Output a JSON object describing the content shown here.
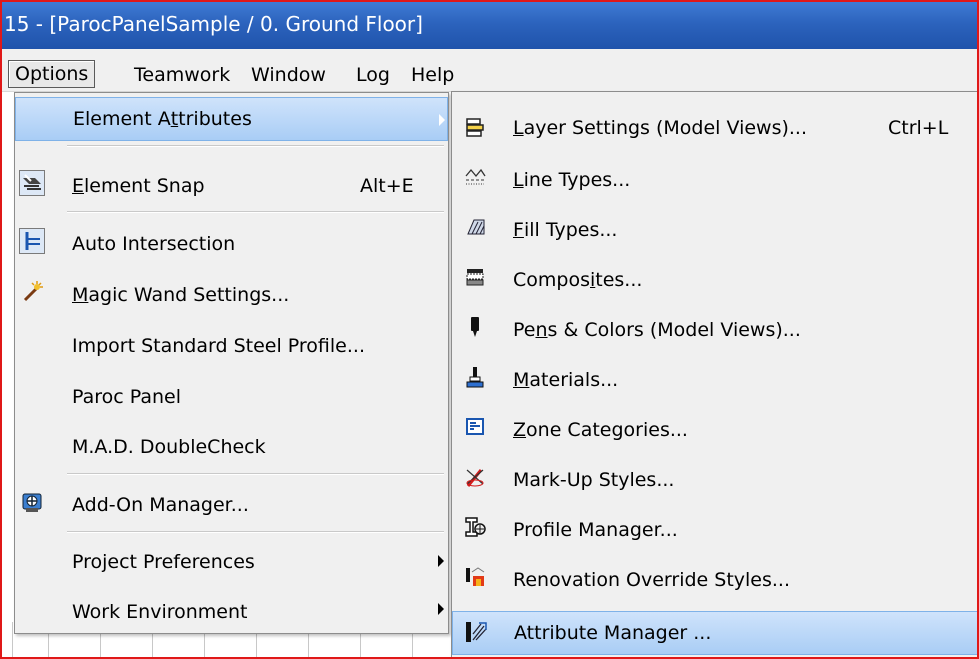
{
  "window": {
    "title": "15 - [ParocPanelSample / 0. Ground Floor]"
  },
  "menubar": [
    "Options",
    "Teamwork",
    "Window",
    "Log",
    "Help"
  ],
  "options_menu": [
    {
      "label": "Element Attributes",
      "shortcut": "",
      "icon": "",
      "submenu": true,
      "highlighted": true
    },
    {
      "label": "Element Snap",
      "shortcut": "Alt+E",
      "icon": "snap-icon",
      "submenu": false
    },
    {
      "label": "Auto Intersection",
      "shortcut": "",
      "icon": "intersection-icon",
      "submenu": false
    },
    {
      "label": "Magic Wand Settings...",
      "shortcut": "",
      "icon": "magic-wand-icon",
      "submenu": false
    },
    {
      "label": "Import Standard Steel Profile...",
      "shortcut": "",
      "icon": "",
      "submenu": false
    },
    {
      "label": "Paroc Panel",
      "shortcut": "",
      "icon": "",
      "submenu": false
    },
    {
      "label": "M.A.D. DoubleCheck",
      "shortcut": "",
      "icon": "",
      "submenu": false
    },
    {
      "label": "Add-On Manager...",
      "shortcut": "",
      "icon": "addon-manager-icon",
      "submenu": false
    },
    {
      "label": "Project Preferences",
      "shortcut": "",
      "icon": "",
      "submenu": true
    },
    {
      "label": "Work Environment",
      "shortcut": "",
      "icon": "",
      "submenu": true
    }
  ],
  "attributes_submenu": [
    {
      "label": "Layer Settings (Model Views)...",
      "shortcut": "Ctrl+L",
      "icon": "layers-icon"
    },
    {
      "label": "Line Types...",
      "shortcut": "",
      "icon": "line-types-icon"
    },
    {
      "label": "Fill Types...",
      "shortcut": "",
      "icon": "fill-types-icon"
    },
    {
      "label": "Composites...",
      "shortcut": "",
      "icon": "composites-icon"
    },
    {
      "label": "Pens & Colors (Model Views)...",
      "shortcut": "",
      "icon": "pen-icon"
    },
    {
      "label": "Materials...",
      "shortcut": "",
      "icon": "materials-icon"
    },
    {
      "label": "Zone Categories...",
      "shortcut": "",
      "icon": "zone-icon"
    },
    {
      "label": "Mark-Up Styles...",
      "shortcut": "",
      "icon": "markup-icon"
    },
    {
      "label": "Profile Manager...",
      "shortcut": "",
      "icon": "profile-manager-icon"
    },
    {
      "label": "Renovation Override Styles...",
      "shortcut": "",
      "icon": "renovation-icon"
    },
    {
      "label": "Attribute Manager ...",
      "shortcut": "",
      "icon": "attribute-manager-icon",
      "highlighted": true
    }
  ]
}
